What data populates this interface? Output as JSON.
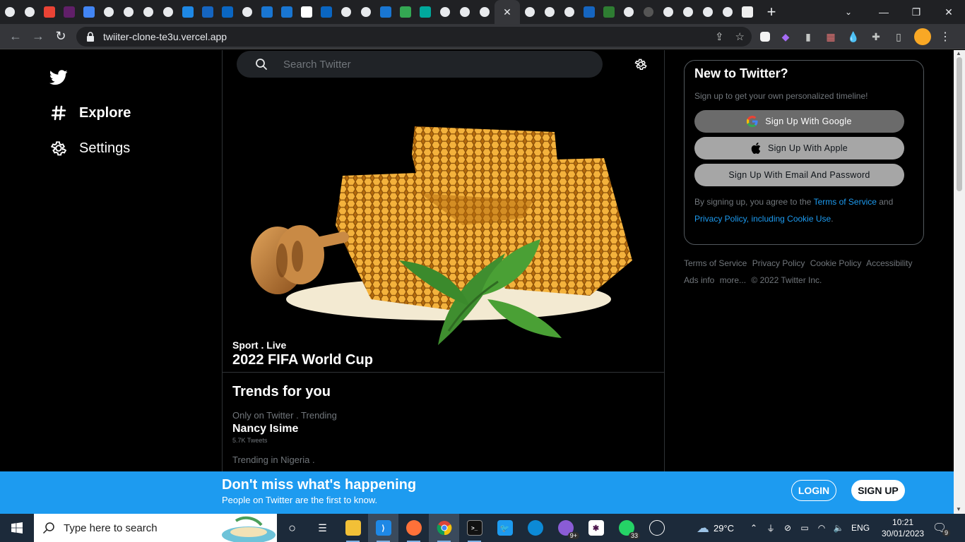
{
  "browser": {
    "url": "twiiter-clone-te3u.vercel.app",
    "tab_favicons": [
      "twitter-like",
      "globe",
      "gmail",
      "slack",
      "docs",
      "globe",
      "drop",
      "drive-folder",
      "globe",
      "at",
      "F",
      "in",
      "camera",
      "IS",
      "IS",
      "G",
      "in",
      "globe",
      "globe",
      "IS",
      "drive",
      "cf",
      "globe",
      "triangle",
      "seal"
    ],
    "tab_favicons_after": [
      "grid",
      "triangle",
      "bot",
      "TS",
      "TWiX",
      "globe",
      "github",
      "globe",
      "triangle",
      "drop",
      "drop",
      "doc"
    ]
  },
  "sidebar": {
    "explore_label": "Explore",
    "settings_label": "Settings"
  },
  "search": {
    "placeholder": "Search Twitter"
  },
  "hero": {
    "meta": "Sport . Live",
    "title": "2022 FIFA World Cup"
  },
  "trends": {
    "heading": "Trends for you",
    "items": [
      {
        "context": "Only on Twitter . Trending",
        "name": "Nancy Isime",
        "count": "5.7K Tweets"
      },
      {
        "context": "Trending in Nigeria .",
        "name": "",
        "count": ""
      }
    ]
  },
  "signup_card": {
    "title": "New to Twitter?",
    "subtitle": "Sign up to get your own personalized timeline!",
    "google_label": "Sign Up With Google",
    "apple_label": "Sign Up With Apple",
    "email_label": "Sign Up With Email And Password",
    "terms_prefix": "By signing up, you agree to the ",
    "terms_link": "Terms of Service",
    "terms_and": " and",
    "privacy_link": "Privacy Policy, including Cookie Use",
    "terms_end": "."
  },
  "footer": {
    "links": [
      "Terms of Service",
      "Privacy Policy",
      "Cookie Policy",
      "Accessibility",
      "Ads info",
      "more...",
      "© 2022 Twitter Inc."
    ]
  },
  "banner": {
    "title": "Don't miss what's happening",
    "subtitle": "People on Twitter are the first to know.",
    "login_label": "LOGIN",
    "signup_label": "SIGN UP"
  },
  "taskbar": {
    "search_placeholder": "Type here to search",
    "temperature": "29°C",
    "language": "ENG",
    "time": "10:21",
    "date": "30/01/2023",
    "notification_count": "9",
    "whatsapp_badge": "33",
    "copilot_badge": "9+"
  },
  "colors": {
    "accent": "#1d9bf0",
    "background": "#000000",
    "border": "#2f3336",
    "muted_text": "#71767b"
  }
}
